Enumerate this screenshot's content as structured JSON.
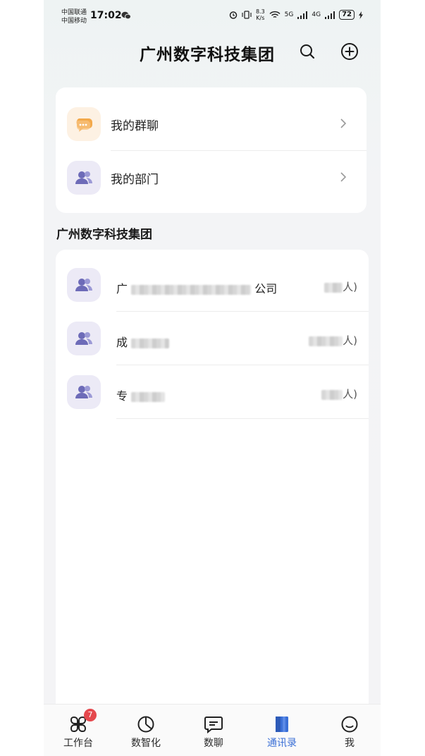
{
  "status_bar": {
    "carrier1": "中国联通",
    "carrier2": "中国移动",
    "time": "17:02",
    "net_speed_value": "8.3",
    "net_speed_unit": "K/s",
    "signal1": "5G",
    "signal2": "4G",
    "battery": "72"
  },
  "header": {
    "title": "广州数字科技集团"
  },
  "quick_list": [
    {
      "label": "我的群聊",
      "icon": "group-chat-icon"
    },
    {
      "label": "我的部门",
      "icon": "department-icon"
    }
  ],
  "section": {
    "title": "广州数字科技集团"
  },
  "orgs": [
    {
      "prefix": "广",
      "suffix": "公司",
      "count_suffix": "人)"
    },
    {
      "prefix": "成",
      "suffix": "",
      "count_suffix": "人)"
    },
    {
      "prefix": "专",
      "suffix": "",
      "count_suffix": "人)"
    }
  ],
  "tabbar": {
    "tabs": [
      {
        "label": "工作台",
        "badge": "7"
      },
      {
        "label": "数智化"
      },
      {
        "label": "数聊"
      },
      {
        "label": "通讯录",
        "active": true
      },
      {
        "label": "我"
      }
    ]
  },
  "colors": {
    "accent": "#3a6fd6",
    "badge": "#e5484d",
    "avatar_purple": "#6d6bb8",
    "avatar_orange": "#f0a54a"
  }
}
